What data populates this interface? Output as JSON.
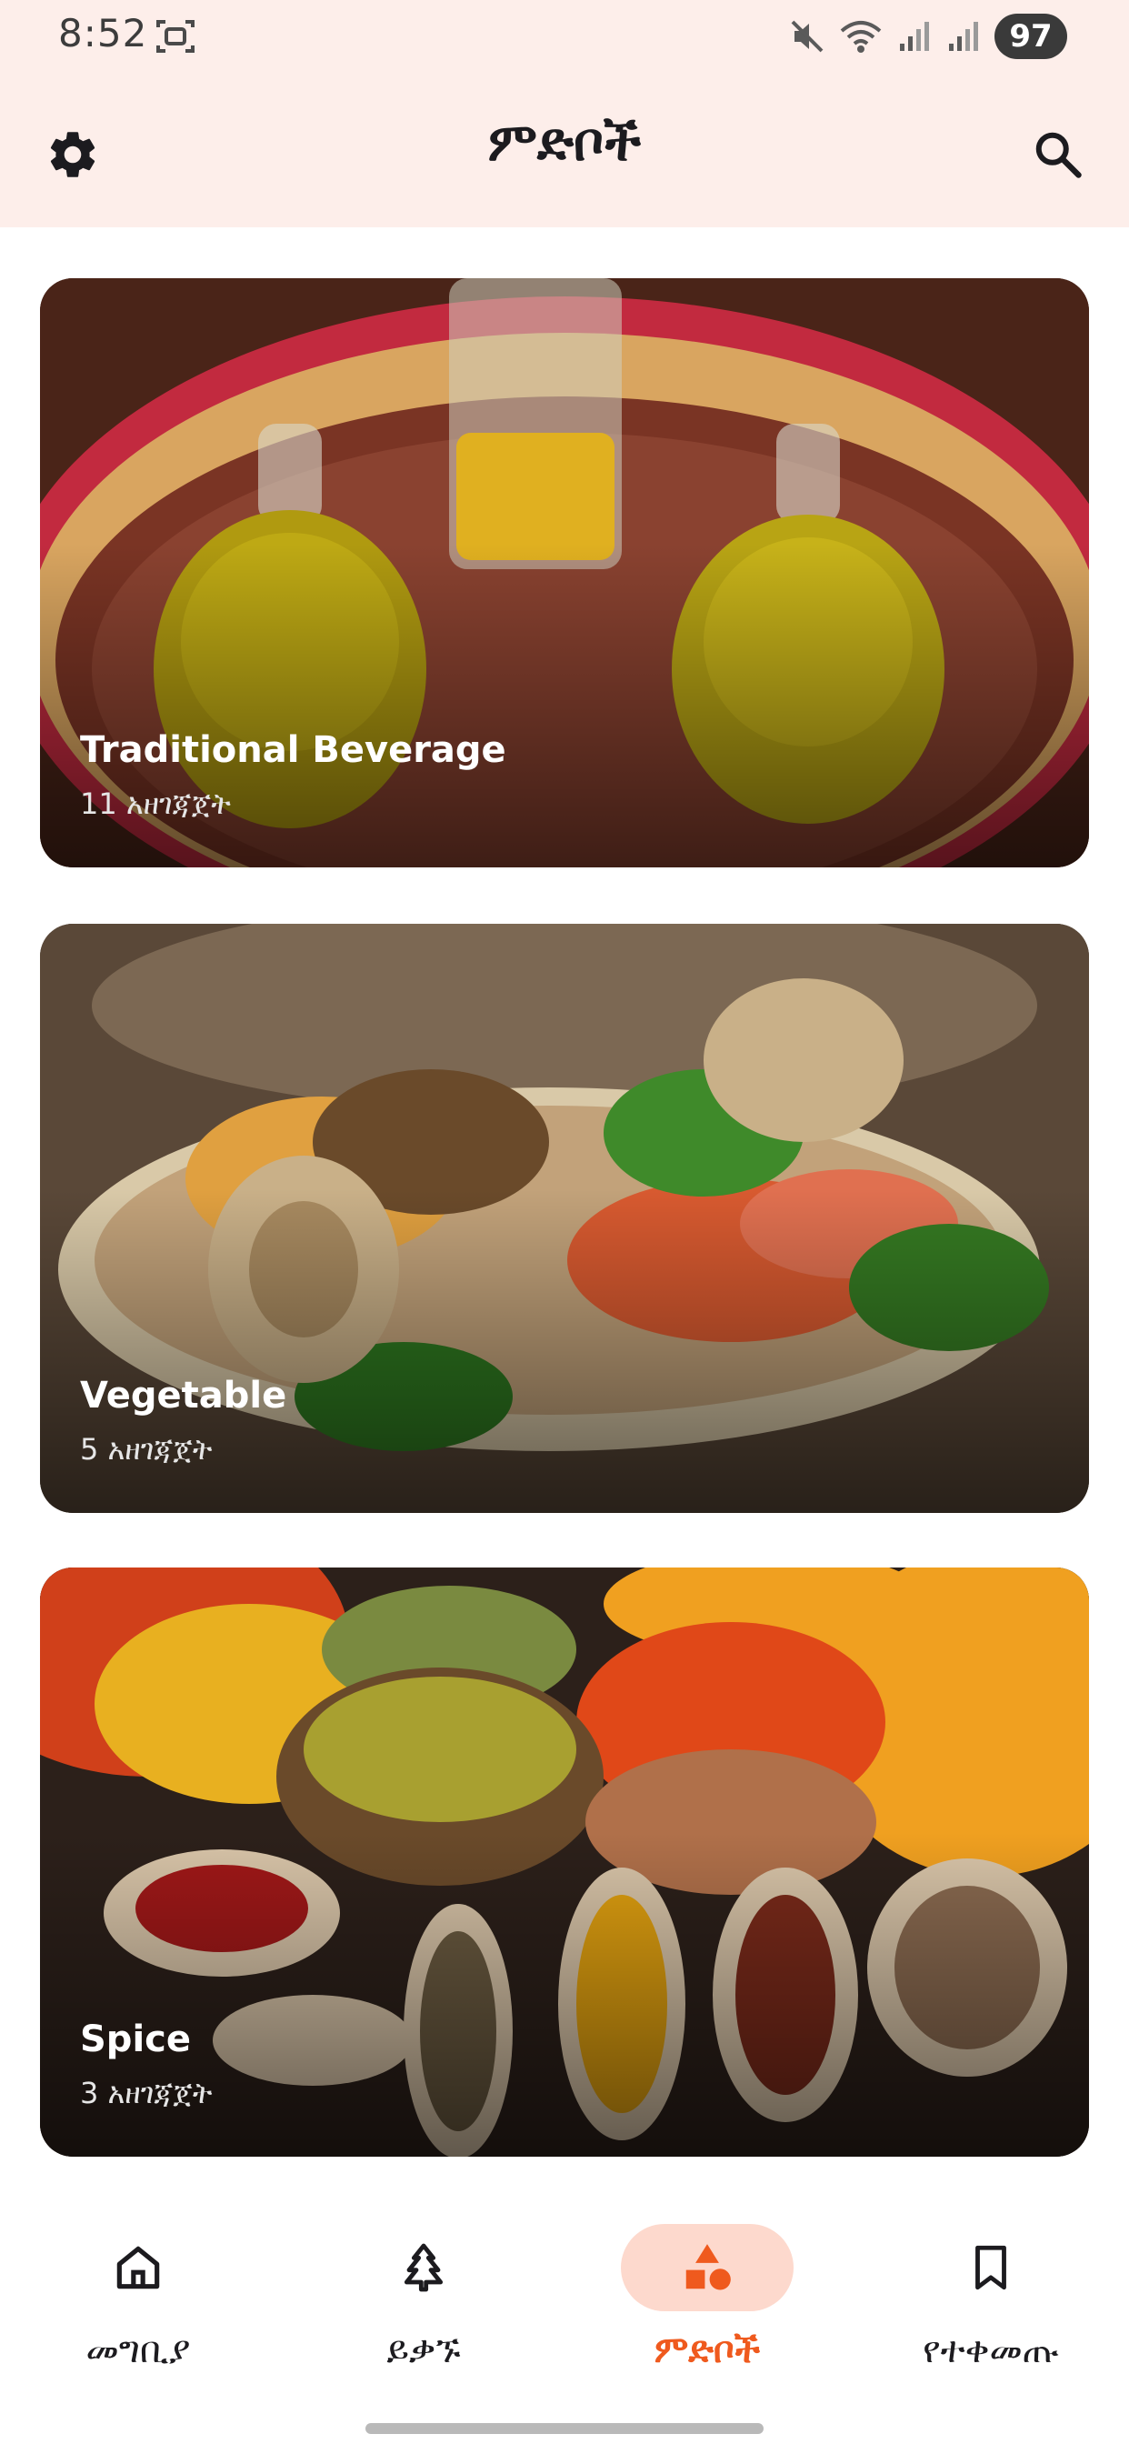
{
  "status_bar": {
    "time": "8:52",
    "battery": "97",
    "icons": [
      "screenshot-icon",
      "mute-icon",
      "wifi-icon",
      "signal-icon",
      "signal-icon"
    ]
  },
  "app_bar": {
    "title": "ምድቦች",
    "settings_icon": "gear-icon",
    "search_icon": "search-icon"
  },
  "categories": [
    {
      "title": "Traditional Beverage",
      "count": "11 አዘገጃጀት"
    },
    {
      "title": "Vegetable",
      "count": "5 አዘገጃጀት"
    },
    {
      "title": "Spice",
      "count": "3 አዘገጃጀት"
    }
  ],
  "bottom_nav": {
    "items": [
      {
        "label": "መግቢያ",
        "icon": "home-icon",
        "active": false
      },
      {
        "label": "ይቃኙ",
        "icon": "explore-icon",
        "active": false
      },
      {
        "label": "ምድቦች",
        "icon": "categories-icon",
        "active": true
      },
      {
        "label": "የተቀመጡ",
        "icon": "bookmark-icon",
        "active": false
      }
    ]
  },
  "colors": {
    "accent": "#ef5a1e",
    "app_bar_bg": "#fdeeea",
    "active_pill": "#fdd9cd"
  }
}
